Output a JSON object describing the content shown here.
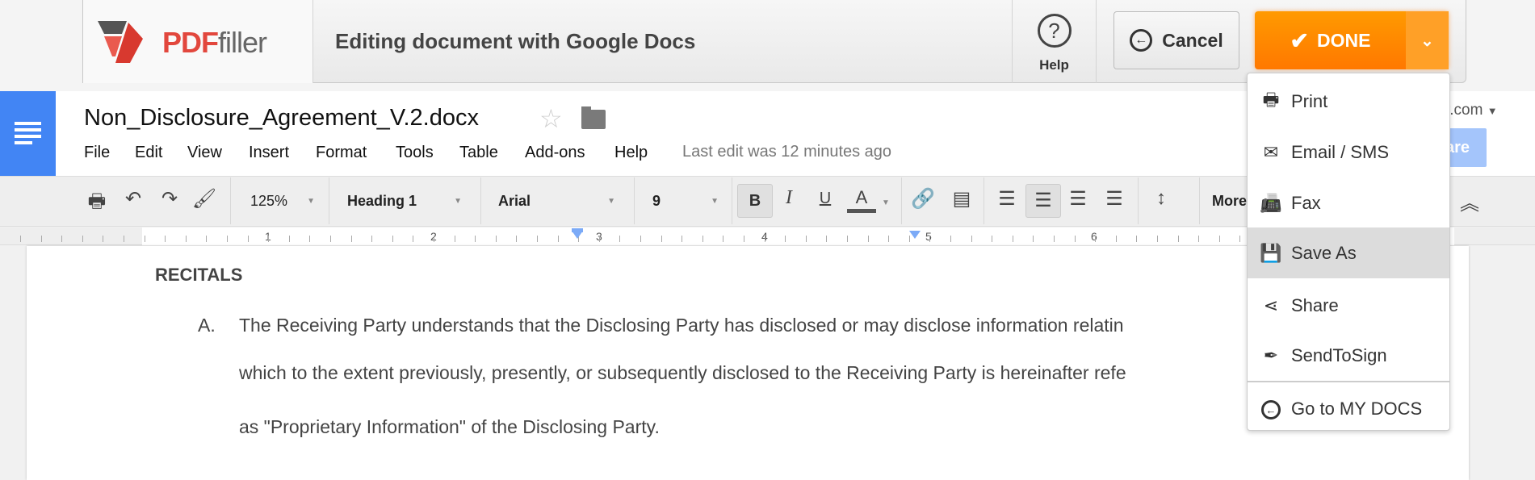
{
  "pdffiller": {
    "logo_text": "PDFfiller",
    "logo_pdf": "PDF",
    "logo_filler": "filler",
    "header_title": "Editing document with Google Docs",
    "help_label": "Help",
    "cancel_label": "Cancel",
    "done_label": "DONE",
    "accent_color": "#ff8000",
    "done_menu": [
      {
        "label": "Print",
        "icon": "printer-icon"
      },
      {
        "label": "Email / SMS",
        "icon": "envelope-icon"
      },
      {
        "label": "Fax",
        "icon": "fax-icon"
      },
      {
        "label": "Save As",
        "icon": "floppy-disk-icon",
        "highlighted": true
      },
      {
        "label": "Share",
        "icon": "share-icon"
      },
      {
        "label": "SendToSign",
        "icon": "quill-icon"
      },
      {
        "label": "Go to MY DOCS",
        "icon": "circle-arrow-left-icon"
      }
    ]
  },
  "docs": {
    "title": "Non_Disclosure_Agreement_V.2.docx",
    "menu": [
      "File",
      "Edit",
      "View",
      "Insert",
      "Format",
      "Tools",
      "Table",
      "Add-ons",
      "Help"
    ],
    "last_edit": "Last edit was 12 minutes ago",
    "account_partial": "r.com",
    "share_partial": "are",
    "toolbar": {
      "zoom": "125%",
      "style": "Heading 1",
      "font": "Arial",
      "size": "9",
      "bold": "B",
      "italic": "I",
      "underline": "U",
      "text_color": "A",
      "more": "More"
    },
    "ruler_numbers": [
      "1",
      "2",
      "3",
      "4",
      "5",
      "6"
    ]
  },
  "document": {
    "heading": "RECITALS",
    "item_marker": "A.",
    "lines": [
      "The Receiving Party understands that the Disclosing Party has disclosed or may disclose information relatin",
      "which to the extent previously, presently, or subsequently disclosed to the Receiving Party is hereinafter refe",
      "as \"Proprietary Information\" of the Disclosing Party."
    ]
  }
}
